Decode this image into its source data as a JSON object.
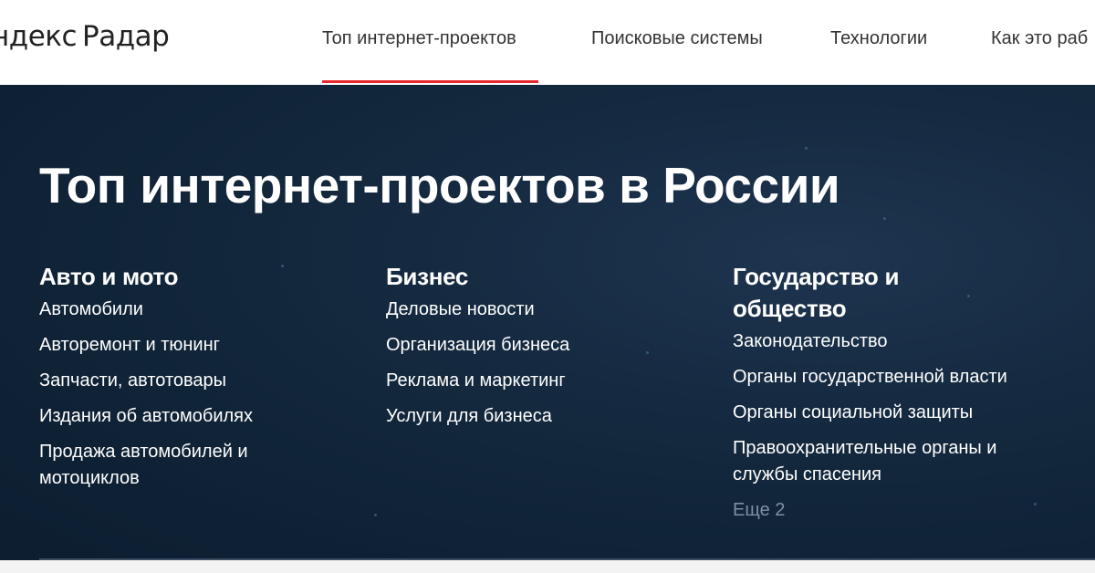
{
  "header": {
    "logo_brand": "ндекс",
    "logo_product": "Радар",
    "nav": [
      {
        "label": "Топ интернет-проектов",
        "active": true
      },
      {
        "label": "Поисковые системы",
        "active": false
      },
      {
        "label": "Технологии",
        "active": false
      },
      {
        "label": "Как это раб",
        "active": false
      }
    ],
    "accent_color": "#e8262b"
  },
  "hero": {
    "title": "Топ интернет-проектов в России",
    "columns": [
      {
        "heading": "Авто и мото",
        "links": [
          "Автомобили",
          "Авторемонт и тюнинг",
          "Запчасти, автотовары",
          "Издания об автомобилях",
          "Продажа автомобилей и мотоциклов"
        ]
      },
      {
        "heading": "Бизнес",
        "links": [
          "Деловые новости",
          "Организация бизнеса",
          "Реклама и маркетинг",
          "Услуги для бизнеса"
        ]
      },
      {
        "heading": "Государство и общество",
        "links": [
          "Законодательство",
          "Органы государственной власти",
          "Органы социальной защиты",
          "Правоохранительные органы и службы спасения"
        ],
        "more": "Еще 2"
      }
    ]
  }
}
